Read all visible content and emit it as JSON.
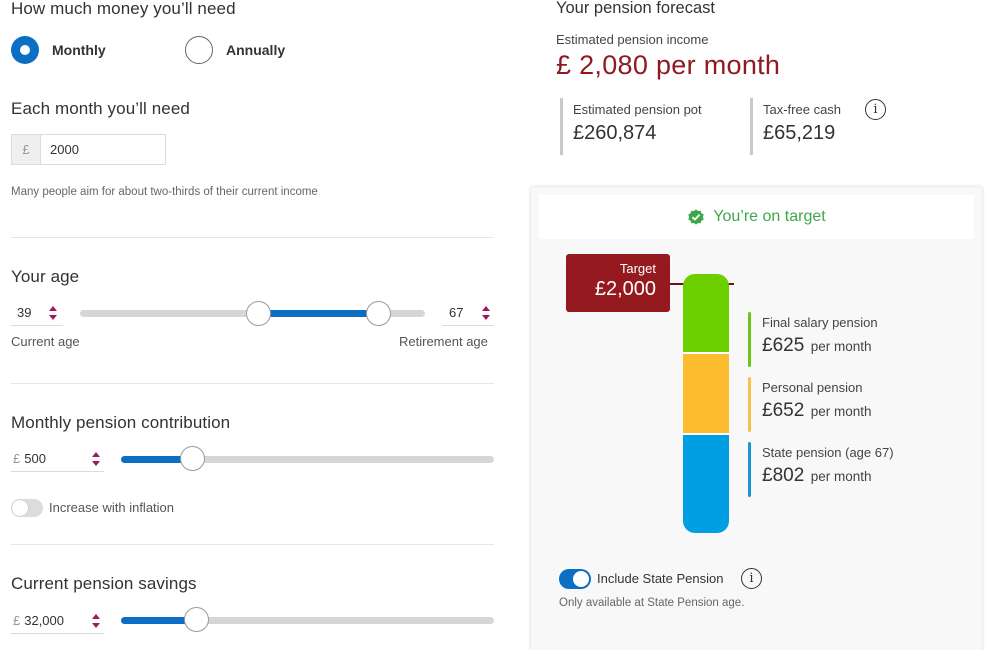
{
  "left": {
    "money_needed": {
      "title": "How much money you’ll need",
      "frequency_options": [
        {
          "label": "Monthly",
          "selected": true
        },
        {
          "label": "Annually",
          "selected": false
        }
      ]
    },
    "monthly_need": {
      "title": "Each month you’ll need",
      "currency_symbol": "£",
      "value": "2000",
      "hint": "Many people aim for about two-thirds of their current income"
    },
    "age": {
      "title": "Your age",
      "current_age": "39",
      "retirement_age": "67",
      "current_age_label": "Current age",
      "retirement_age_label": "Retirement age"
    },
    "contribution": {
      "title": "Monthly pension contribution",
      "currency_symbol": "£",
      "value": "500",
      "slider_fraction": 0.19,
      "inflation_toggle_label": "Increase with inflation",
      "inflation_toggle_on": false
    },
    "savings": {
      "title": "Current pension savings",
      "currency_symbol": "£",
      "value": "32,000",
      "slider_fraction": 0.2
    }
  },
  "right": {
    "title": "Your pension forecast",
    "income_label": "Estimated pension income",
    "income_value": "£ 2,080 per month",
    "stats": [
      {
        "label": "Estimated pension pot",
        "value": "£260,874"
      },
      {
        "label": "Tax-free cash",
        "value": "£65,219",
        "has_info": true
      }
    ],
    "card": {
      "status_text": "You’re on target",
      "status_icon": "verified-check-badge",
      "status_color": "#3da84a",
      "target_label": "Target",
      "target_value": "£2,000",
      "breakdown": [
        {
          "label": "Final salary pension",
          "amount": "£625",
          "unit": "per month",
          "value": 625,
          "color": "#6cd000",
          "legend_color": "#6cc419"
        },
        {
          "label": "Personal pension",
          "amount": "£652",
          "unit": "per month",
          "value": 652,
          "color": "#fbbc2e",
          "legend_color": "#f3c24b"
        },
        {
          "label": "State pension (age 67)",
          "amount": "£802",
          "unit": "per month",
          "value": 802,
          "color": "#009fe3",
          "legend_color": "#1a96d4"
        }
      ],
      "include_state_pension_label": "Include State Pension",
      "include_state_pension_on": true,
      "state_pension_hint": "Only available at State Pension age."
    }
  },
  "colors": {
    "accent_blue": "#0c6fc4",
    "brand_red": "#8e1b23",
    "spinner_magenta": "#a0185e"
  }
}
